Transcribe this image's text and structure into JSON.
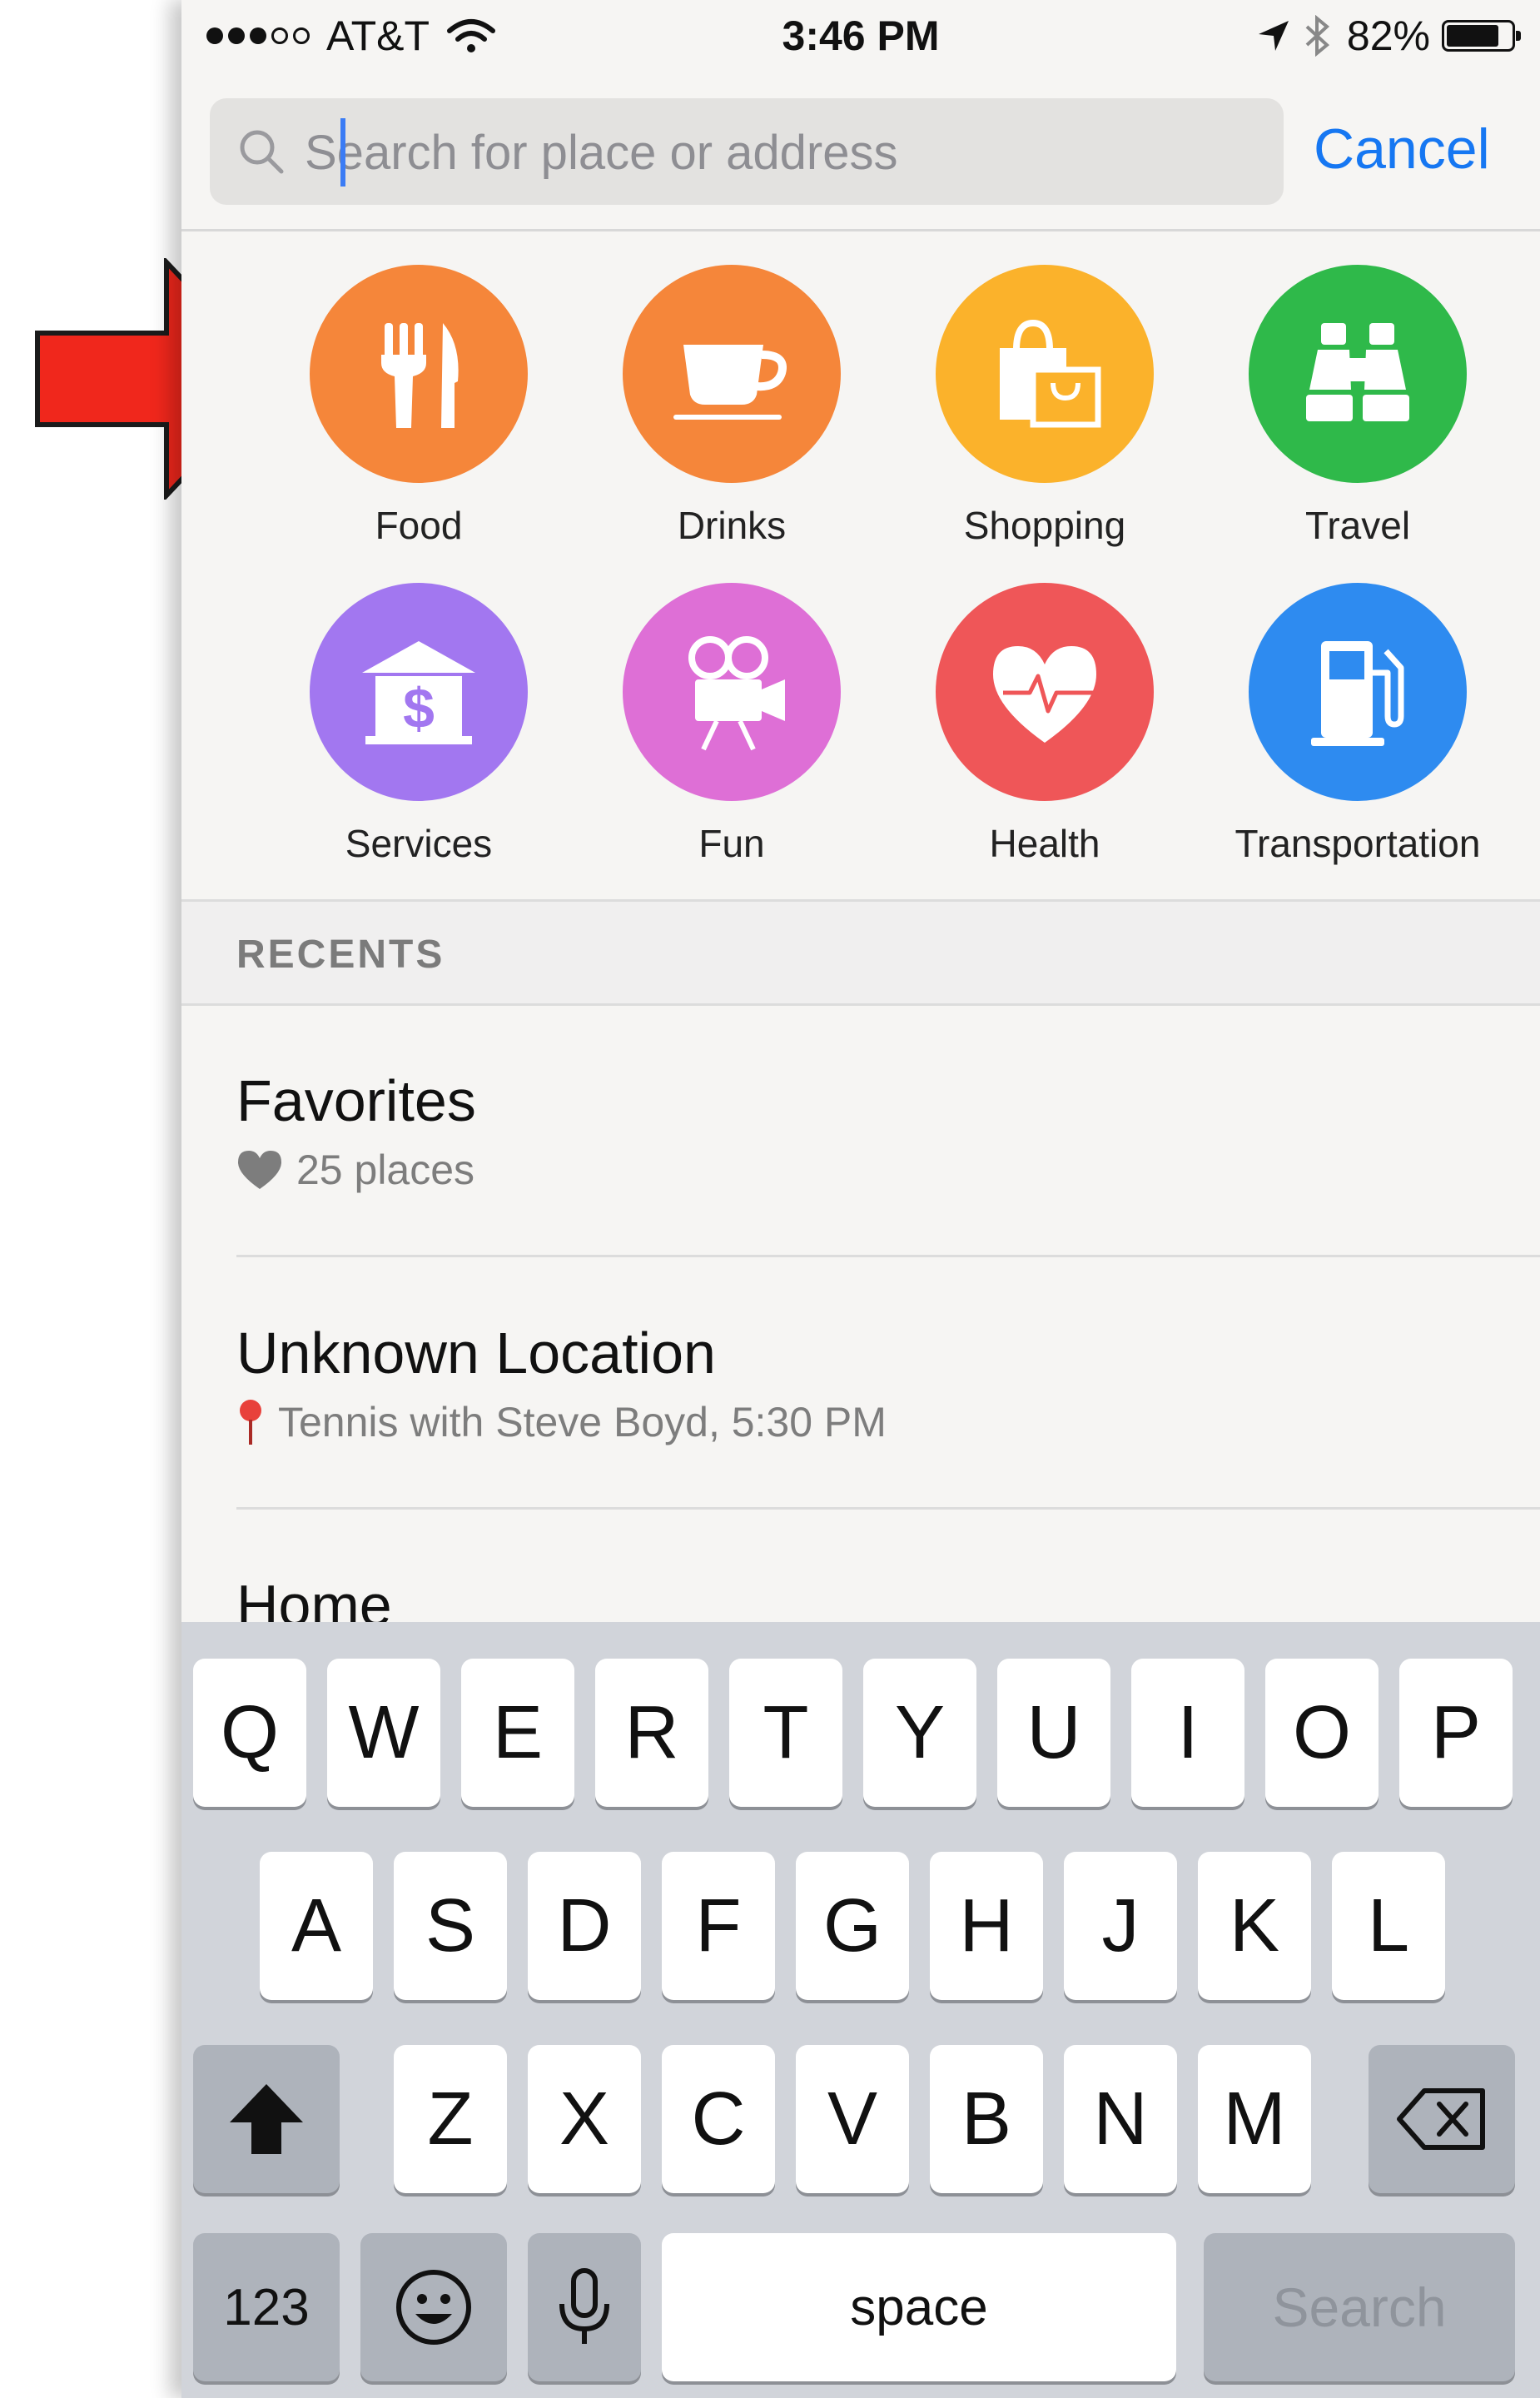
{
  "status_bar": {
    "carrier": "AT&T",
    "time": "3:46 PM",
    "battery": "82%",
    "battery_level": 0.82,
    "signal_bars_filled": 3,
    "signal_bars_total": 5
  },
  "search": {
    "placeholder": "Search for place or address",
    "value": "",
    "cancel_label": "Cancel"
  },
  "categories": [
    {
      "label": "Food",
      "color": "#f5863a",
      "icon": "fork-knife-icon"
    },
    {
      "label": "Drinks",
      "color": "#f5863a",
      "icon": "coffee-cup-icon"
    },
    {
      "label": "Shopping",
      "color": "#fbb22b",
      "icon": "shopping-bags-icon"
    },
    {
      "label": "Travel",
      "color": "#2fb94a",
      "icon": "binoculars-icon"
    },
    {
      "label": "Services",
      "color": "#a277f0",
      "icon": "bank-icon"
    },
    {
      "label": "Fun",
      "color": "#de6fd6",
      "icon": "movie-camera-icon"
    },
    {
      "label": "Health",
      "color": "#ef5658",
      "icon": "heart-pulse-icon"
    },
    {
      "label": "Transportation",
      "color": "#2e8bf0",
      "icon": "fuel-pump-icon"
    }
  ],
  "recents": {
    "header": "RECENTS",
    "items": [
      {
        "title": "Favorites",
        "subtitle": "25 places",
        "icon": "heart-icon"
      },
      {
        "title": "Unknown Location",
        "subtitle": "Tennis with Steve Boyd, 5:30 PM",
        "icon": "map-pin-icon"
      },
      {
        "title": "Home",
        "subtitle": ""
      }
    ]
  },
  "keyboard": {
    "row1": [
      "Q",
      "W",
      "E",
      "R",
      "T",
      "Y",
      "U",
      "I",
      "O",
      "P"
    ],
    "row2": [
      "A",
      "S",
      "D",
      "F",
      "G",
      "H",
      "J",
      "K",
      "L"
    ],
    "row3": [
      "Z",
      "X",
      "C",
      "V",
      "B",
      "N",
      "M"
    ],
    "numbers_label": "123",
    "space_label": "space",
    "search_label": "Search"
  },
  "colors": {
    "accent": "#1677f2",
    "annotation_arrow": "#f0271c"
  }
}
